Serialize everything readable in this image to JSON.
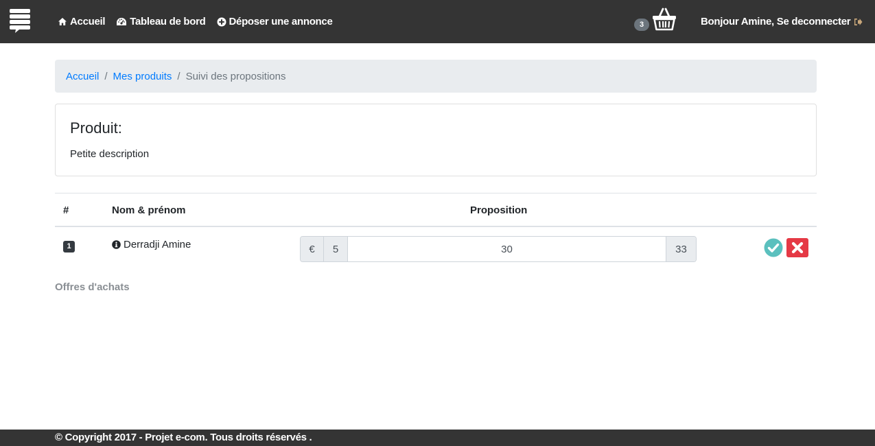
{
  "navbar": {
    "links": [
      {
        "label": "Accueil",
        "icon": "home-icon"
      },
      {
        "label": "Tableau de bord",
        "icon": "dashboard-icon"
      },
      {
        "label": "Déposer une annonce",
        "icon": "plus-circle-icon"
      }
    ],
    "cart_count": "3",
    "user_link": "Bonjour Amine, Se deconnecter",
    "logout_icon_color": "#c9a77a"
  },
  "breadcrumb": {
    "items": [
      "Accueil",
      "Mes produits"
    ],
    "active": "Suivi des propositions"
  },
  "card": {
    "title": "Produit:",
    "description": "Petite description"
  },
  "table": {
    "headers": [
      "#",
      "Nom & prénom",
      "Proposition"
    ],
    "rows": [
      {
        "num": "1",
        "name": "Derradji Amine",
        "currency": "€",
        "min": "5",
        "value": "30",
        "max": "33"
      }
    ]
  },
  "offers_label": "Offres d'achats",
  "footer": "© Copyright 2017 - Projet e-com. Tous droits réservés .",
  "colors": {
    "navbar": "#343434",
    "link": "#007bff",
    "accept": "#5bc0be",
    "reject": "#e53945"
  }
}
